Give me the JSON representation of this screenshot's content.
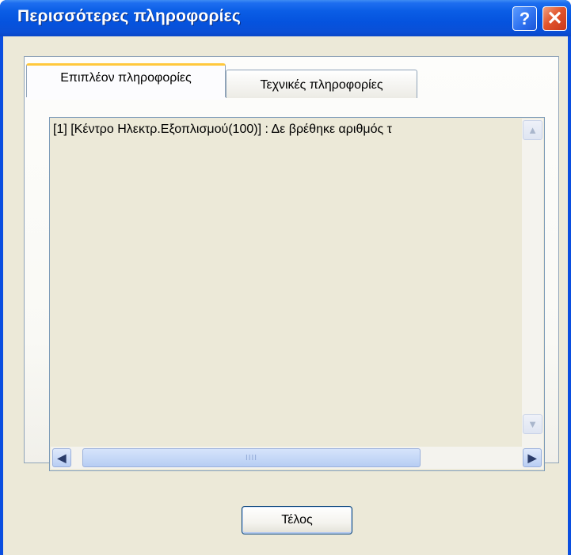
{
  "window": {
    "title": "Περισσότερες πληροφορίες",
    "help_glyph": "?",
    "close_glyph": "✕"
  },
  "tabs": [
    {
      "label": "Επιπλέον πληροφορίες",
      "selected": true
    },
    {
      "label": "Τεχνικές πληροφορίες",
      "selected": false
    }
  ],
  "list": {
    "items": [
      "[1] [Κέντρο Ηλεκτρ.Εξοπλισμού(100)] : Δε βρέθηκε αριθμός τ"
    ]
  },
  "scrollbars": {
    "up_arrow": "▲",
    "down_arrow": "▼",
    "left_arrow": "◀",
    "right_arrow": "▶",
    "thumb_grip": "IIII"
  },
  "buttons": {
    "ok_label": "Τέλος"
  },
  "colors": {
    "titlebar": "#0553de",
    "window_body": "#ece9d8",
    "tab_highlight": "#ffc83c",
    "button_border": "#003c74"
  }
}
